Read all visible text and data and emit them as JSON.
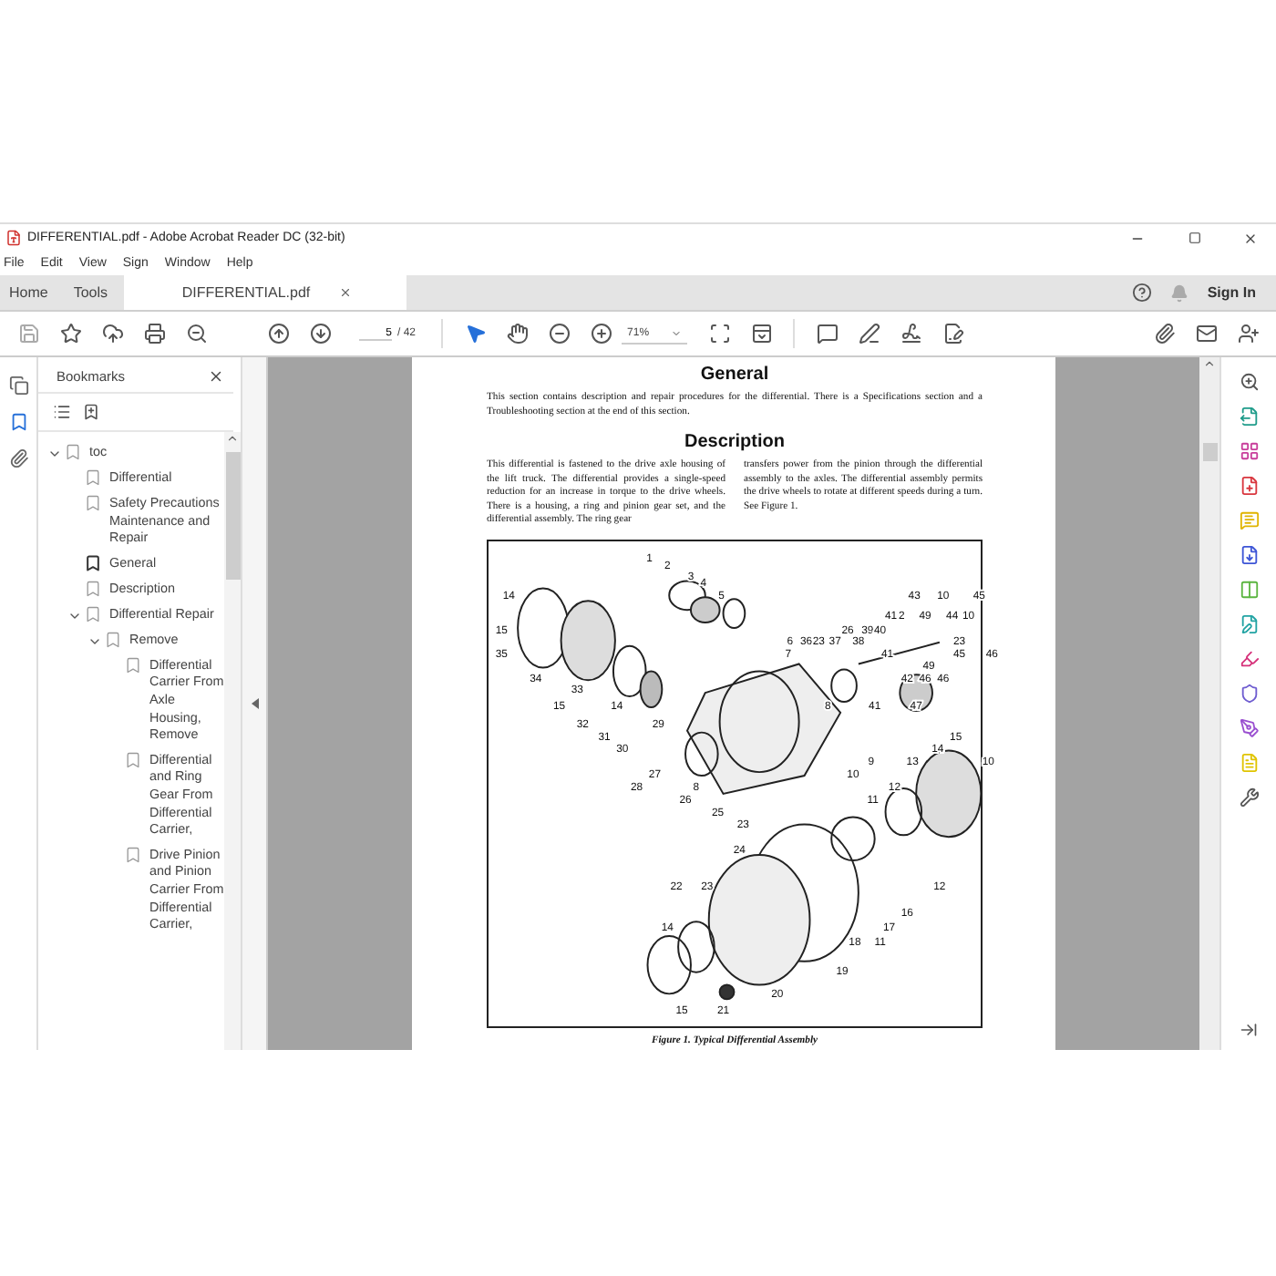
{
  "window": {
    "title": "DIFFERENTIAL.pdf - Adobe Acrobat Reader DC (32-bit)"
  },
  "menu": [
    "File",
    "Edit",
    "View",
    "Sign",
    "Window",
    "Help"
  ],
  "tabs": [
    {
      "label": "Home",
      "selected": false
    },
    {
      "label": "Tools",
      "selected": false
    },
    {
      "label": "DIFFERENTIAL.pdf",
      "selected": true
    }
  ],
  "account": {
    "sign_in": "Sign In"
  },
  "toolbar": {
    "page": "5",
    "page_total": "/ 42",
    "zoom": "71%"
  },
  "sidebar": {
    "title": "Bookmarks",
    "bookmarks": [
      {
        "label": "toc",
        "expanded": true,
        "children": [
          {
            "label": "Differential",
            "selected": false
          },
          {
            "label": "Safety Precautions Maintenance and Repair",
            "selected": false
          },
          {
            "label": "General",
            "selected": true
          },
          {
            "label": "Description",
            "selected": false
          },
          {
            "label": "Differential Repair",
            "selected": false,
            "expanded": true,
            "children": [
              {
                "label": "Remove",
                "selected": false,
                "expanded": true,
                "children": [
                  {
                    "label": "Differential Carrier From Axle Housing, Remove",
                    "selected": false
                  },
                  {
                    "label": "Differential and Ring Gear From Differential Carrier,",
                    "selected": false
                  },
                  {
                    "label": "Drive Pinion and Pinion Carrier From Differential Carrier,",
                    "selected": false
                  }
                ]
              }
            ]
          }
        ]
      }
    ]
  },
  "document": {
    "general": {
      "heading": "General",
      "text": "This section contains description and repair procedures for the differential. There is a Specifications section and a Troubleshooting section at the end of this section."
    },
    "description": {
      "heading": "Description",
      "columns": [
        "This differential is fastened to the drive axle housing of the lift truck. The differential provides a single-speed reduction for an increase in torque to the drive wheels. There is a housing, a ring and pinion gear set, and the differential assembly. The ring gear",
        "transfers power from the pinion through the differential assembly to the axles. The differential assembly permits the drive wheels to rotate at different speeds during a turn. See Figure 1."
      ]
    },
    "figure": {
      "callouts": [
        "1",
        "2",
        "3",
        "4",
        "14",
        "5",
        "43",
        "10",
        "45",
        "41",
        "2",
        "49",
        "44",
        "10",
        "15",
        "26",
        "39",
        "40",
        "6",
        "36",
        "23",
        "37",
        "38",
        "23",
        "35",
        "7",
        "41",
        "45",
        "46",
        "49",
        "34",
        "42",
        "46",
        "46",
        "33",
        "15",
        "14",
        "8",
        "41",
        "47",
        "32",
        "29",
        "31",
        "15",
        "30",
        "14",
        "9",
        "13",
        "10",
        "27",
        "10",
        "28",
        "8",
        "12",
        "26",
        "11",
        "25",
        "23",
        "24",
        "22",
        "23",
        "12",
        "16",
        "14",
        "17",
        "18",
        "11",
        "19",
        "20",
        "15",
        "21"
      ],
      "caption": "Figure 1. Typical Differential Assembly"
    }
  }
}
